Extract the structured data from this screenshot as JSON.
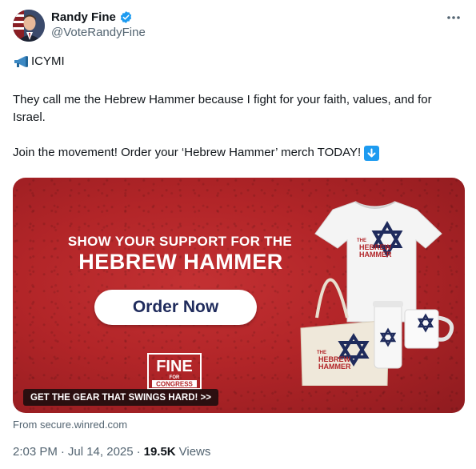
{
  "author": {
    "name": "Randy Fine",
    "handle": "@VoteRandyFine",
    "verified": true,
    "verified_color": "#1d9bf0"
  },
  "more_icon": "more-horizontal-icon",
  "tweet": {
    "line1_emoji": "megaphone-icon",
    "line1_text": "ICYMI",
    "para2": "They call me the Hebrew Hammer because I fight for your faith, values, and for Israel.",
    "para3": "Join the movement! Order your ‘Hebrew Hammer’ merch TODAY!",
    "para3_emoji": "down-arrow-icon"
  },
  "card": {
    "headline1": "SHOW YOUR SUPPORT FOR THE",
    "headline2": "HEBREW HAMMER",
    "button_label": "Order Now",
    "logo_main": "FINE",
    "logo_sub1": "FOR",
    "logo_sub2": "CONGRESS",
    "cta": "GET THE GEAR THAT SWINGS HARD! >>",
    "product_text_top": "THE",
    "product_text_mid": "HEBREW",
    "product_text_bottom": "HAMMER",
    "colors": {
      "red": "#b22528",
      "navy": "#1f2b5c"
    }
  },
  "source": "From secure.winred.com",
  "meta": {
    "time": "2:03 PM",
    "date": "Jul 14, 2025",
    "views_count": "19.5K",
    "views_label": "Views"
  }
}
